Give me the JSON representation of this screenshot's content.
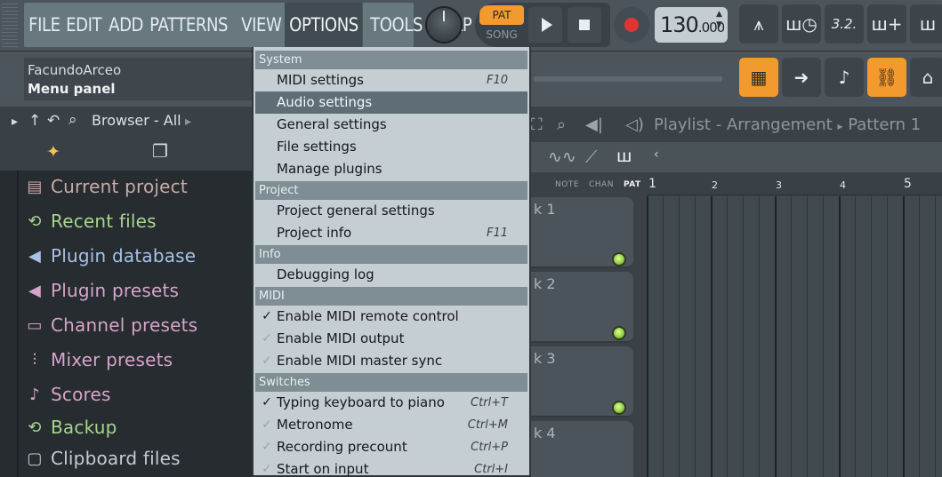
{
  "menubar": {
    "items": [
      "FILE",
      "EDIT",
      "ADD",
      "PATTERNS",
      "VIEW",
      "OPTIONS",
      "TOOLS",
      "HELP"
    ],
    "active": "OPTIONS"
  },
  "transport": {
    "pat_label": "PAT",
    "song_label": "SONG",
    "tempo": "130",
    "tempo_decimal": ".000"
  },
  "toolbar_right": {
    "row1": [
      "metronome-icon",
      "wait-icon",
      "countdown-icon",
      "step-edit-icon",
      "scroll-icon"
    ],
    "row2": [
      "typing-keyboard-icon",
      "arrow-icon",
      "blend-icon",
      "link-icon",
      "mixer-icon"
    ],
    "counter_text": "3.2."
  },
  "hint": {
    "user": "FacundoArceo",
    "text": "Menu panel"
  },
  "browser": {
    "title": "Browser - All",
    "items": [
      {
        "label": "Current project",
        "color": "#c9aba7",
        "icon": "document-icon",
        "glyph": "▤"
      },
      {
        "label": "Recent files",
        "color": "#a7d58f",
        "icon": "recent-folder-icon",
        "glyph": "⟲"
      },
      {
        "label": "Plugin database",
        "color": "#a7c1e3",
        "icon": "speaker-icon",
        "glyph": "◀"
      },
      {
        "label": "Plugin presets",
        "color": "#d7a3c9",
        "icon": "speaker-icon",
        "glyph": "◀"
      },
      {
        "label": "Channel presets",
        "color": "#d7a3c9",
        "icon": "channel-icon",
        "glyph": "▭"
      },
      {
        "label": "Mixer presets",
        "color": "#d7a3c9",
        "icon": "mixer-fader-icon",
        "glyph": "⫶"
      },
      {
        "label": "Scores",
        "color": "#d7a3c9",
        "icon": "note-icon",
        "glyph": "♪"
      },
      {
        "label": "Backup",
        "color": "#a7d58f",
        "icon": "backup-folder-icon",
        "glyph": "⟲"
      },
      {
        "label": "Clipboard files",
        "color": "#c2ccd1",
        "icon": "clipboard-folder-icon",
        "glyph": "▢"
      }
    ]
  },
  "playlist": {
    "title": "Playlist - Arrangement",
    "pattern": "Pattern 1",
    "mini_labels": [
      "NOTE",
      "CHAN",
      "PAT"
    ],
    "ruler": [
      "1",
      "2",
      "3",
      "4",
      "5"
    ],
    "tracks": [
      "k 1",
      "k 2",
      "k 3",
      "k 4"
    ]
  },
  "options_menu": {
    "sections": [
      {
        "title": "System",
        "items": [
          {
            "label": "MIDI settings",
            "shortcut": "F10",
            "check": ""
          },
          {
            "label": "Audio settings",
            "shortcut": "",
            "check": "",
            "highlight": true
          },
          {
            "label": "General settings",
            "shortcut": "",
            "check": ""
          },
          {
            "label": "File settings",
            "shortcut": "",
            "check": ""
          },
          {
            "label": "Manage plugins",
            "shortcut": "",
            "check": ""
          }
        ]
      },
      {
        "title": "Project",
        "items": [
          {
            "label": "Project general settings",
            "shortcut": "",
            "check": ""
          },
          {
            "label": "Project info",
            "shortcut": "F11",
            "check": ""
          }
        ]
      },
      {
        "title": "Info",
        "items": [
          {
            "label": "Debugging log",
            "shortcut": "",
            "check": ""
          }
        ]
      },
      {
        "title": "MIDI",
        "items": [
          {
            "label": "Enable MIDI remote control",
            "shortcut": "",
            "check": "on"
          },
          {
            "label": "Enable MIDI output",
            "shortcut": "",
            "check": "off"
          },
          {
            "label": "Enable MIDI master sync",
            "shortcut": "",
            "check": "off"
          }
        ]
      },
      {
        "title": "Switches",
        "items": [
          {
            "label": "Typing keyboard to piano",
            "shortcut": "Ctrl+T",
            "check": "on"
          },
          {
            "label": "Metronome",
            "shortcut": "Ctrl+M",
            "check": "off"
          },
          {
            "label": "Recording precount",
            "shortcut": "Ctrl+P",
            "check": "off"
          },
          {
            "label": "Start on input",
            "shortcut": "Ctrl+I",
            "check": "off"
          }
        ]
      }
    ]
  },
  "colors": {
    "accent_orange": "#f29a2e",
    "menu_bg": "#c5ced3",
    "menu_highlight": "#5f6e76",
    "record_red": "#e03434",
    "led_green": "#8bcf3a"
  }
}
